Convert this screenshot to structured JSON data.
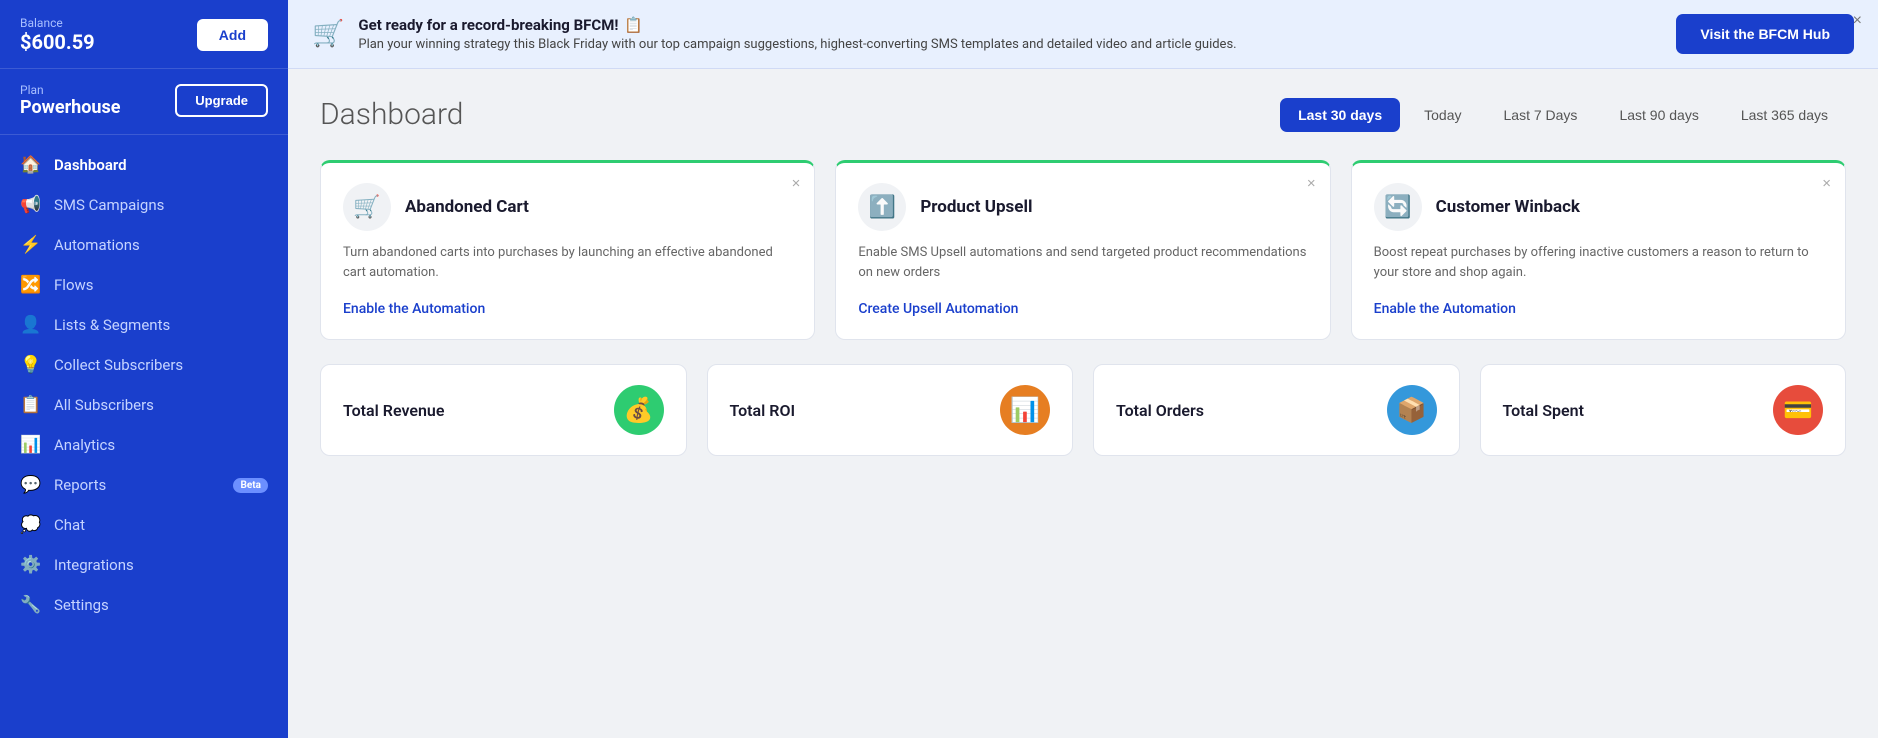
{
  "sidebar": {
    "balance_label": "Balance",
    "balance_amount": "$600.59",
    "add_button": "Add",
    "plan_label": "Plan",
    "plan_name": "Powerhouse",
    "upgrade_button": "Upgrade",
    "nav_items": [
      {
        "id": "dashboard",
        "label": "Dashboard",
        "icon": "🏠",
        "active": true
      },
      {
        "id": "sms-campaigns",
        "label": "SMS Campaigns",
        "icon": "📢",
        "active": false
      },
      {
        "id": "automations",
        "label": "Automations",
        "icon": "⚡",
        "active": false
      },
      {
        "id": "flows",
        "label": "Flows",
        "icon": "🔀",
        "active": false
      },
      {
        "id": "lists-segments",
        "label": "Lists & Segments",
        "icon": "👤",
        "active": false
      },
      {
        "id": "collect-subscribers",
        "label": "Collect Subscribers",
        "icon": "💡",
        "active": false
      },
      {
        "id": "all-subscribers",
        "label": "All Subscribers",
        "icon": "📋",
        "active": false
      },
      {
        "id": "analytics",
        "label": "Analytics",
        "icon": "📊",
        "active": false
      },
      {
        "id": "reports",
        "label": "Reports",
        "icon": "💬",
        "active": false,
        "badge": "Beta"
      },
      {
        "id": "chat",
        "label": "Chat",
        "icon": "💭",
        "active": false
      },
      {
        "id": "integrations",
        "label": "Integrations",
        "icon": "⚙️",
        "active": false
      },
      {
        "id": "settings",
        "label": "Settings",
        "icon": "🔧",
        "active": false
      }
    ]
  },
  "banner": {
    "icon": "🛒",
    "title": "Get ready for a record-breaking BFCM!",
    "title_emoji": "📋",
    "description": "Plan your winning strategy this Black Friday with our top campaign suggestions, highest-converting SMS templates and detailed video and article guides.",
    "button_label": "Visit the BFCM Hub",
    "close_label": "×"
  },
  "dashboard": {
    "title": "Dashboard",
    "time_filters": [
      {
        "id": "last-30",
        "label": "Last 30 days",
        "active": true
      },
      {
        "id": "today",
        "label": "Today",
        "active": false
      },
      {
        "id": "last-7",
        "label": "Last 7 Days",
        "active": false
      },
      {
        "id": "last-90",
        "label": "Last 90 days",
        "active": false
      },
      {
        "id": "last-365",
        "label": "Last 365 days",
        "active": false
      }
    ],
    "automation_cards": [
      {
        "id": "abandoned-cart",
        "title": "Abandoned Cart",
        "description": "Turn abandoned carts into purchases by launching an effective abandoned cart automation.",
        "link_label": "Enable the Automation",
        "icon": "🛒"
      },
      {
        "id": "product-upsell",
        "title": "Product Upsell",
        "description": "Enable SMS Upsell automations and send targeted product recommendations on new orders",
        "link_label": "Create Upsell Automation",
        "icon": "⬆️"
      },
      {
        "id": "customer-winback",
        "title": "Customer Winback",
        "description": "Boost repeat purchases by offering inactive customers a reason to return to your store and shop again.",
        "link_label": "Enable the Automation",
        "icon": "🔄"
      }
    ],
    "stat_cards": [
      {
        "id": "total-revenue",
        "label": "Total Revenue",
        "icon": "💰",
        "icon_color": "green"
      },
      {
        "id": "total-roi",
        "label": "Total ROI",
        "icon": "📊",
        "icon_color": "orange"
      },
      {
        "id": "total-orders",
        "label": "Total Orders",
        "icon": "📦",
        "icon_color": "blue"
      },
      {
        "id": "total-spent",
        "label": "Total Spent",
        "icon": "💳",
        "icon_color": "pink"
      }
    ]
  }
}
